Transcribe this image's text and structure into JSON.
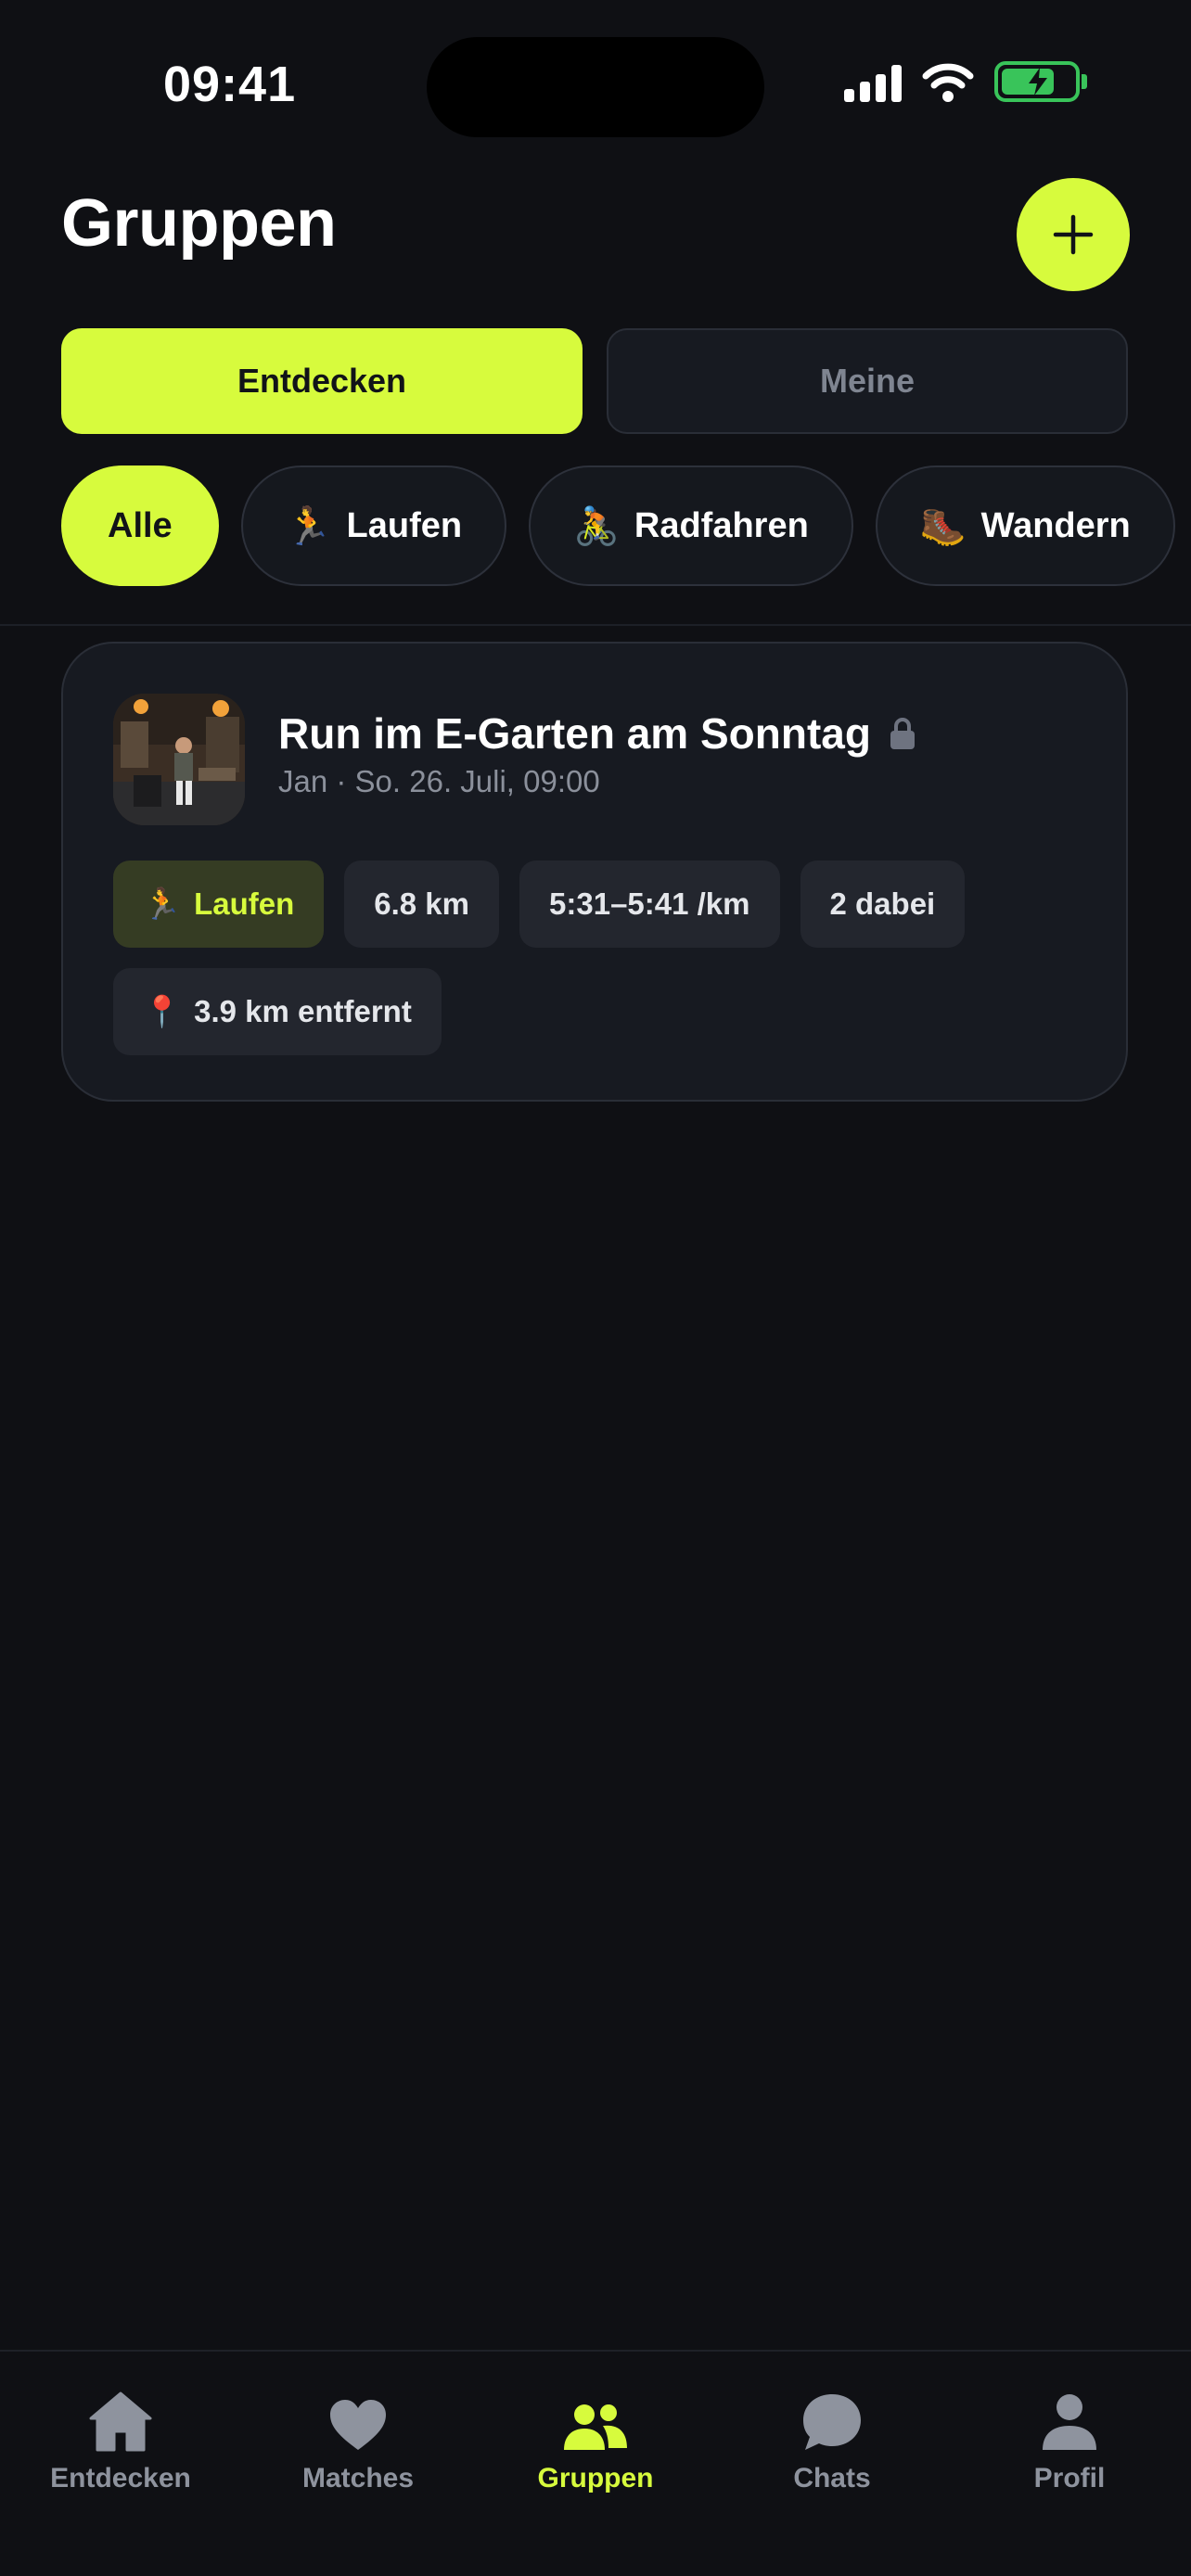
{
  "status_bar": {
    "time": "09:41"
  },
  "header": {
    "title": "Gruppen"
  },
  "segments": {
    "discover": "Entdecken",
    "mine": "Meine"
  },
  "filters": [
    {
      "label": "Alle",
      "emoji": ""
    },
    {
      "label": "Laufen",
      "emoji": "🏃"
    },
    {
      "label": "Radfahren",
      "emoji": "🚴"
    },
    {
      "label": "Wandern",
      "emoji": "🥾"
    }
  ],
  "group_card": {
    "title": "Run im E-Garten am Sonntag",
    "subtitle": "Jan · So. 26. Juli, 09:00",
    "sport": {
      "emoji": "🏃",
      "label": "Laufen"
    },
    "distance": "6.8 km",
    "pace": "5:31–5:41 /km",
    "participants": "2 dabei",
    "location": {
      "emoji": "📍",
      "label": "3.9 km entfernt"
    }
  },
  "nav": {
    "discover": "Entdecken",
    "matches": "Matches",
    "groups": "Gruppen",
    "chats": "Chats",
    "profile": "Profil"
  },
  "colors": {
    "accent": "#d7fb3d",
    "background": "#0f1014",
    "card": "#171a21",
    "muted_text": "#8e939e",
    "battery": "#39c45a"
  }
}
